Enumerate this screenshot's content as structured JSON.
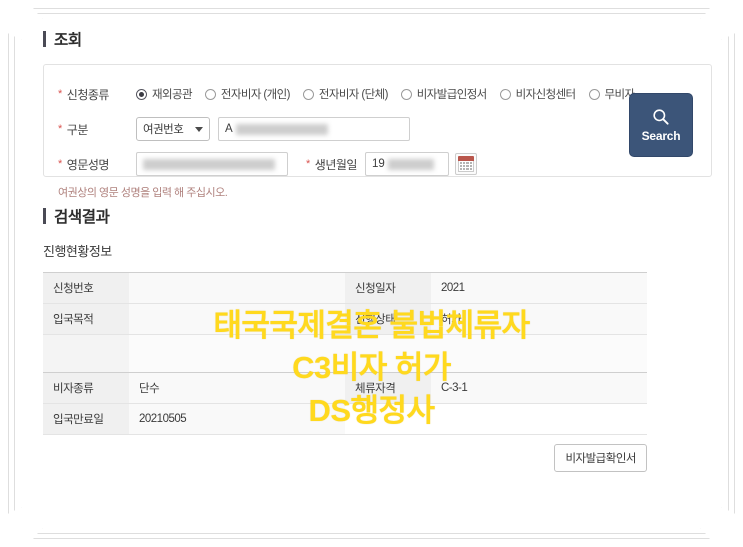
{
  "query_section": {
    "title": "조회",
    "application_type": {
      "label": "신청종류",
      "required_mark": "*",
      "options": [
        {
          "label": "재외공관",
          "selected": true
        },
        {
          "label": "전자비자 (개인)",
          "selected": false
        },
        {
          "label": "전자비자 (단체)",
          "selected": false
        },
        {
          "label": "비자발급인정서",
          "selected": false
        },
        {
          "label": "비자신청센터",
          "selected": false
        },
        {
          "label": "무비자",
          "selected": false
        }
      ]
    },
    "division": {
      "label": "구분",
      "required_mark": "*",
      "select_value": "여권번호",
      "input_value": "A",
      "input_redacted": true
    },
    "english_name": {
      "label": "영문성명",
      "required_mark": "*",
      "input_value": "",
      "input_redacted": true
    },
    "birth_date": {
      "label": "생년월일",
      "required_mark": "*",
      "input_value": "19",
      "input_redacted": true,
      "calendar_icon": "calendar-icon"
    },
    "helper_text": "여권상의 영문 성명을 입력 해 주십시오.",
    "search_button": {
      "label": "Search",
      "icon": "search-icon"
    }
  },
  "results_section": {
    "title": "검색결과",
    "subtitle": "진행현황정보",
    "rows": [
      {
        "left_label": "신청번호",
        "left_value": "",
        "right_label": "신청일자",
        "right_value": "2021"
      },
      {
        "left_label": "입국목적",
        "left_value": "",
        "right_label": "진행상태",
        "right_value": "허가"
      },
      {
        "left_label": "비자종류",
        "left_value": "단수",
        "right_label": "체류자격",
        "right_value": "C-3-1"
      },
      {
        "left_label": "입국만료일",
        "left_value": "20210505",
        "right_label": "",
        "right_value": ""
      }
    ],
    "document_button": "비자발급확인서"
  },
  "watermark": {
    "line1": "태국국제결혼 불법체류자",
    "line2": "C3비자 허가",
    "line3": "DS행정사",
    "color": "#ffd91e"
  }
}
